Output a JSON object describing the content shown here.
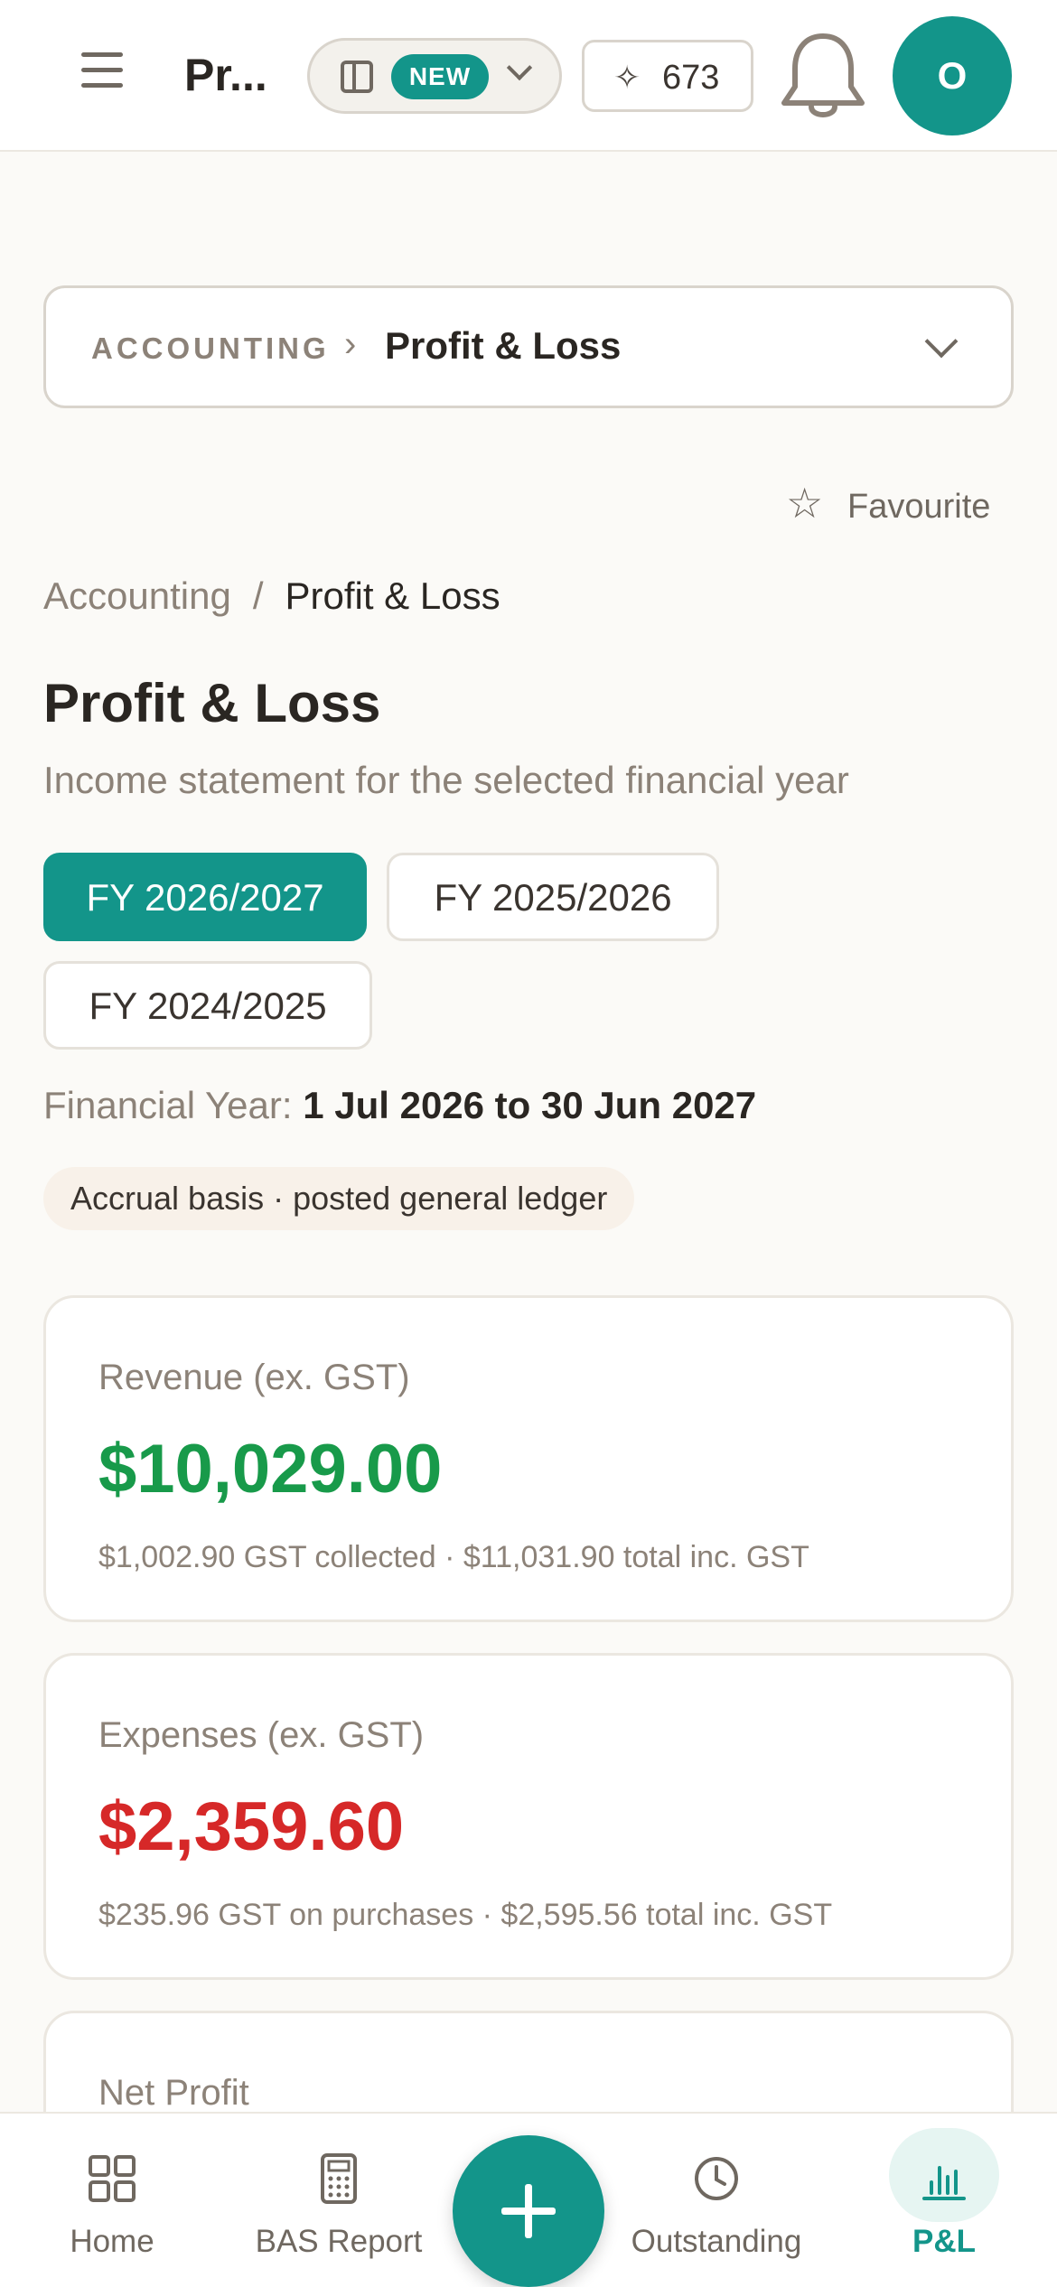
{
  "header": {
    "app_title": "Pr...",
    "new_badge": "NEW",
    "credits": "673",
    "avatar_initial": "O"
  },
  "switcher": {
    "section": "ACCOUNTING",
    "separator": "›",
    "page": "Profit & Loss"
  },
  "favourite_label": "Favourite",
  "breadcrumb": {
    "parent": "Accounting",
    "separator": "/",
    "current": "Profit & Loss"
  },
  "page": {
    "title": "Profit & Loss",
    "subtitle": "Income statement for the selected financial year"
  },
  "fy_chips": [
    {
      "label": "FY 2026/2027",
      "active": true
    },
    {
      "label": "FY 2025/2026",
      "active": false
    },
    {
      "label": "FY 2024/2025",
      "active": false
    }
  ],
  "financial_year": {
    "label": "Financial Year:",
    "range": "1 Jul 2026 to 30 Jun 2027"
  },
  "basis_tag": "Accrual basis · posted general ledger",
  "cards": {
    "revenue": {
      "label": "Revenue (ex. GST)",
      "value": "$10,029.00",
      "detail": "$1,002.90 GST collected · $11,031.90 total inc. GST"
    },
    "expenses": {
      "label": "Expenses (ex. GST)",
      "value": "$2,359.60",
      "detail": "$235.96 GST on purchases · $2,595.56 total inc. GST"
    },
    "net": {
      "label": "Net Profit"
    }
  },
  "bottom_nav": {
    "home": "Home",
    "bas": "BAS Report",
    "outstanding": "Outstanding",
    "pl": "P&L"
  },
  "colors": {
    "accent": "#13958a",
    "positive": "#189a4a",
    "negative": "#d62828"
  }
}
